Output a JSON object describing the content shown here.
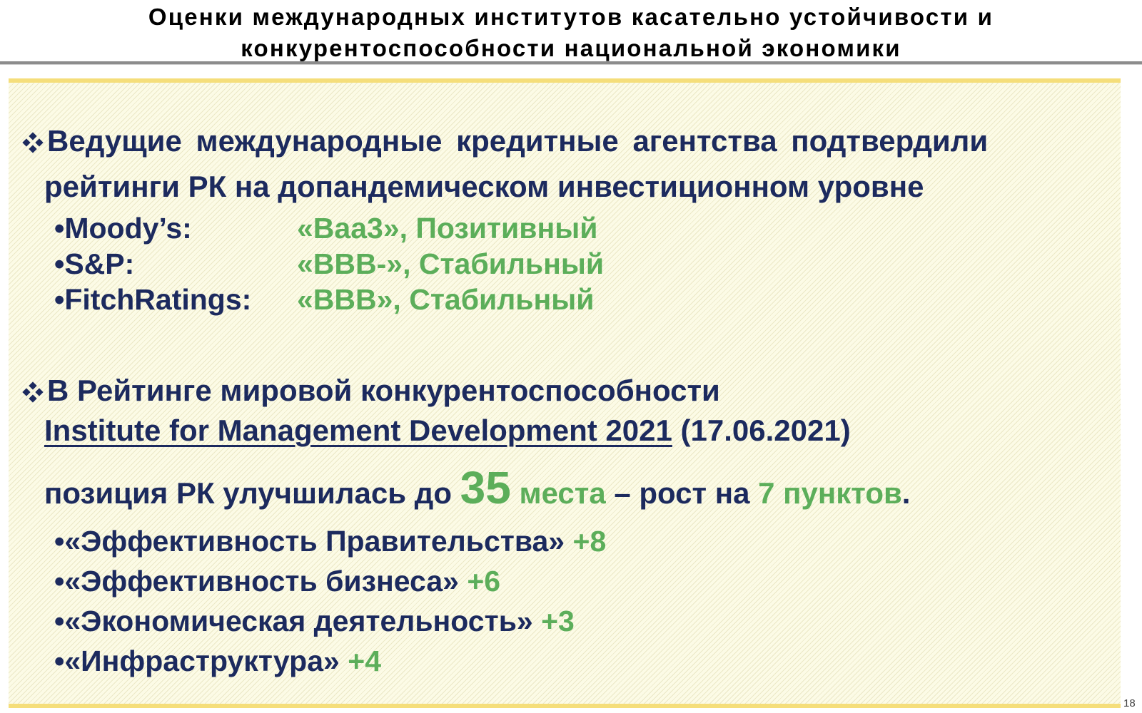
{
  "header": {
    "title_line1": "Оценки международных институтов касательно устойчивости и",
    "title_line2": "конкурентоспособности национальной экономики"
  },
  "section1": {
    "heading_line1": "Ведущие международные кредитные агентства подтвердили",
    "heading_line2": "рейтинги РК на допандемическом инвестиционном уровне",
    "ratings": [
      {
        "agency": "•Moody’s:",
        "value": "«Baa3», Позитивный"
      },
      {
        "agency": "•S&P:",
        "value": "«BBB-», Стабильный"
      },
      {
        "agency": "•FitchRatings:",
        "value": "«BBB», Стабильный"
      }
    ]
  },
  "section2": {
    "heading_line1": "В Рейтинге мировой конкурентоспособности",
    "imd_link": "Institute for Management Development  2021",
    "imd_date": " (17.06.2021)",
    "position_prefix": "позиция РК улучшилась до ",
    "position_value": "35",
    "position_unit": " места",
    "position_mid": " – рост на ",
    "growth_value": "7 пунктов",
    "position_end": ".",
    "factors": [
      {
        "name": "•«Эффективность Правительства»",
        "delta": "+8"
      },
      {
        "name": "•«Эффективность бизнеса»",
        "delta": "+6"
      },
      {
        "name": "•«Экономическая деятельность»",
        "delta": "+3"
      },
      {
        "name": "•«Инфраструктура»",
        "delta": "+4"
      }
    ]
  },
  "footer": {
    "page_number": "18"
  },
  "colors": {
    "navy_text": "#1c2a5e",
    "green_text": "#5cae5a",
    "panel_border": "#f5de7a",
    "header_rule": "#8c8c8c"
  }
}
